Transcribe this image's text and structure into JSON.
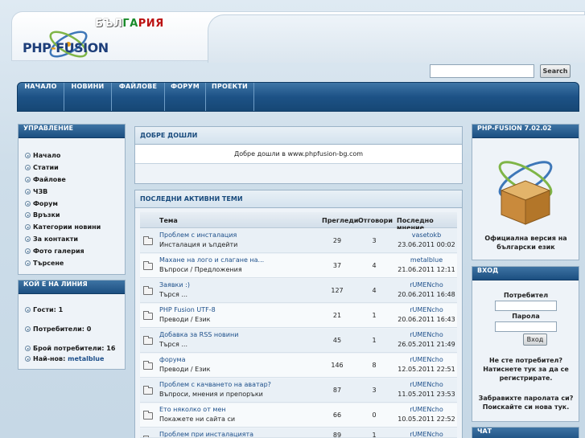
{
  "header": {
    "logo_country": [
      "БЪЛ",
      "ГА",
      "РИЯ"
    ],
    "logo_main": "PHP",
    "logo_fusion": "FUSION",
    "search_button": "Search"
  },
  "nav": [
    "НАЧАЛО",
    "НОВИНИ",
    "ФАЙЛОВЕ",
    "ФОРУМ",
    "ПРОЕКТИ"
  ],
  "left": {
    "menu_title": "УПРАВЛЕНИЕ",
    "menu": [
      "Начало",
      "Статии",
      "Файлове",
      "ЧЗВ",
      "Форум",
      "Връзки",
      "Категории новини",
      "За контакти",
      "Фото галерия",
      "Търсене"
    ],
    "online_title": "КОЙ Е НА ЛИНИЯ",
    "guests_label": "Гости:",
    "guests": "1",
    "users_label": "Потребители:",
    "users": "0",
    "members_label": "Брой потребители:",
    "members": "16",
    "newest_label": "Най-нов:",
    "newest": "metalblue"
  },
  "welcome": {
    "title": "ДОБРЕ ДОШЛИ",
    "text": "Добре дошли в www.phpfusion-bg.com"
  },
  "forum": {
    "title": "ПОСЛЕДНИ АКТИВНИ ТЕМИ",
    "headers": {
      "topic": "Тема",
      "views": "Прегледи",
      "replies": "Отговори",
      "last": "Последно мнение"
    },
    "rows": [
      {
        "title": "Проблем с инсталация",
        "forum": "Инсталация и ъпдейти",
        "views": "29",
        "replies": "3",
        "user": "vasetokb",
        "time": "23.06.2011 00:02"
      },
      {
        "title": "Махане на лого и слагане на...",
        "forum": "Въпроси / Предложения",
        "views": "37",
        "replies": "4",
        "user": "metalblue",
        "time": "21.06.2011 12:11"
      },
      {
        "title": "Заявки :)",
        "forum": "Търся ...",
        "views": "127",
        "replies": "4",
        "user": "rUMENcho",
        "time": "20.06.2011 16:48"
      },
      {
        "title": "PHP Fusion UTF-8",
        "forum": "Преводи / Език",
        "views": "21",
        "replies": "1",
        "user": "rUMENcho",
        "time": "20.06.2011 16:43"
      },
      {
        "title": "Добавка за RSS новини",
        "forum": "Търся ...",
        "views": "45",
        "replies": "1",
        "user": "rUMENcho",
        "time": "26.05.2011 21:49"
      },
      {
        "title": "форума",
        "forum": "Преводи / Език",
        "views": "146",
        "replies": "8",
        "user": "rUMENcho",
        "time": "12.05.2011 22:51"
      },
      {
        "title": "Проблем с качването на аватар?",
        "forum": "Въпроси, мнения и препоръки",
        "views": "87",
        "replies": "3",
        "user": "rUMENcho",
        "time": "11.05.2011 23:53"
      },
      {
        "title": "Ето няколко от мен",
        "forum": "Покажете ни сайта си",
        "views": "66",
        "replies": "0",
        "user": "rUMENcho",
        "time": "10.05.2011 22:52"
      },
      {
        "title": "Проблем при инсталацията",
        "forum": "",
        "views": "89",
        "replies": "1",
        "user": "rUMENcho",
        "time": ""
      }
    ]
  },
  "right": {
    "version_title": "PHP-FUSION 7.02.02",
    "version_caption": "Официална версия на български език",
    "login_title": "ВХОД",
    "username_label": "Потребител",
    "password_label": "Парола",
    "login_button": "Вход",
    "not_registered": "Не сте потребител? Натиснете тук за да се регистрирате.",
    "forgot": "Забравихте паролата си? Поискайте си нова тук.",
    "chat_title": "ЧАТ"
  },
  "colors": {
    "nav_bg": "#1d5286",
    "link": "#1d4f8a",
    "panel_head": "#1c4f81"
  }
}
